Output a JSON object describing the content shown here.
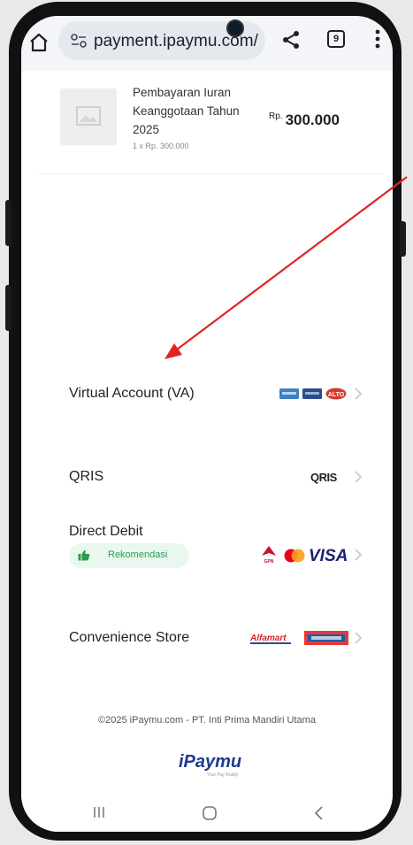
{
  "browser": {
    "url": "payment.ipaymu.com/",
    "tab_count": "9"
  },
  "product": {
    "name": "Pembayaran Iuran Keanggotaan Tahun 2025",
    "quantity": "1 x Rp. 300.000",
    "currency": "Rp.",
    "price": "300.000"
  },
  "payment_methods": [
    {
      "label": "Virtual Account (VA)",
      "logos": [
        "bank-a-logo",
        "bank-b-logo",
        "alto-logo"
      ]
    },
    {
      "label": "QRIS",
      "logos": [
        "qris-logo"
      ]
    },
    {
      "label": "Direct Debit",
      "badge": "Rekomendasi",
      "logos": [
        "gpn-logo",
        "mastercard-logo",
        "visa-logo"
      ]
    },
    {
      "label": "Convenience Store",
      "logos": [
        "alfamart-logo",
        "indomaret-logo"
      ]
    }
  ],
  "logo_text": {
    "qris": "QRIS",
    "visa": "VISA",
    "alfamart": "Alfamart",
    "alto": "ALTO",
    "gpn": "GPN"
  },
  "footer": {
    "copyright": "©2025 iPaymu.com - PT. Inti Prima Mandiri Utama",
    "brand": "iPaymu",
    "tagline": "Your Pay Buddy"
  },
  "colors": {
    "accent_red": "#e02424",
    "brand_blue": "#1f3a8a",
    "recommend_green": "#2e9a51"
  }
}
